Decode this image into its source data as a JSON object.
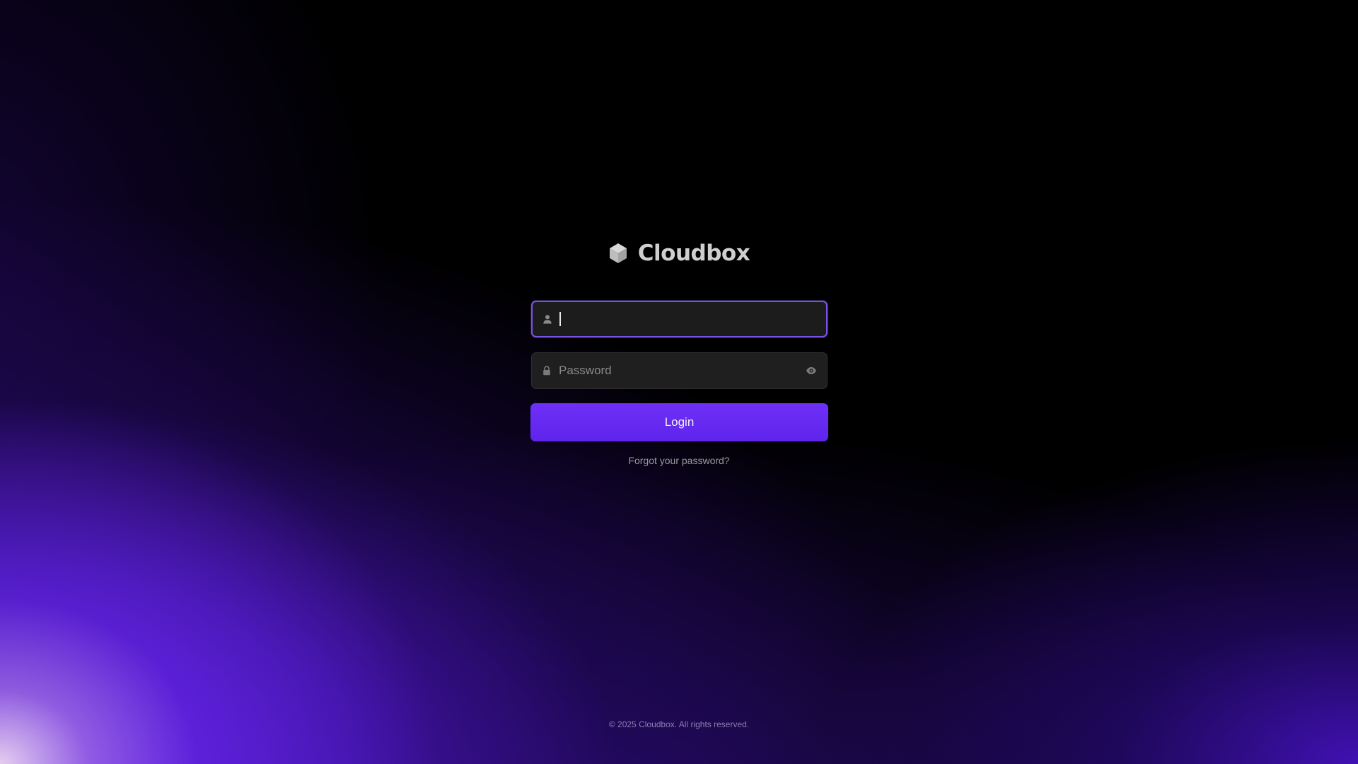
{
  "brand": {
    "name": "Cloudbox",
    "icon": "cube-icon"
  },
  "login_form": {
    "username": {
      "value": "",
      "icon": "user-icon",
      "focused": true
    },
    "password": {
      "placeholder": "Password",
      "icon": "lock-icon",
      "toggle_icon": "eye-icon"
    },
    "login_label": "Login",
    "forgot_label": "Forgot your password?"
  },
  "footer": {
    "copyright": "© 2025 Cloudbox. All rights reserved."
  },
  "colors": {
    "accent": "#6a2bf5",
    "focus_border": "#7a52e6",
    "field_bg": "#1f1f1f",
    "background": "#000000"
  }
}
